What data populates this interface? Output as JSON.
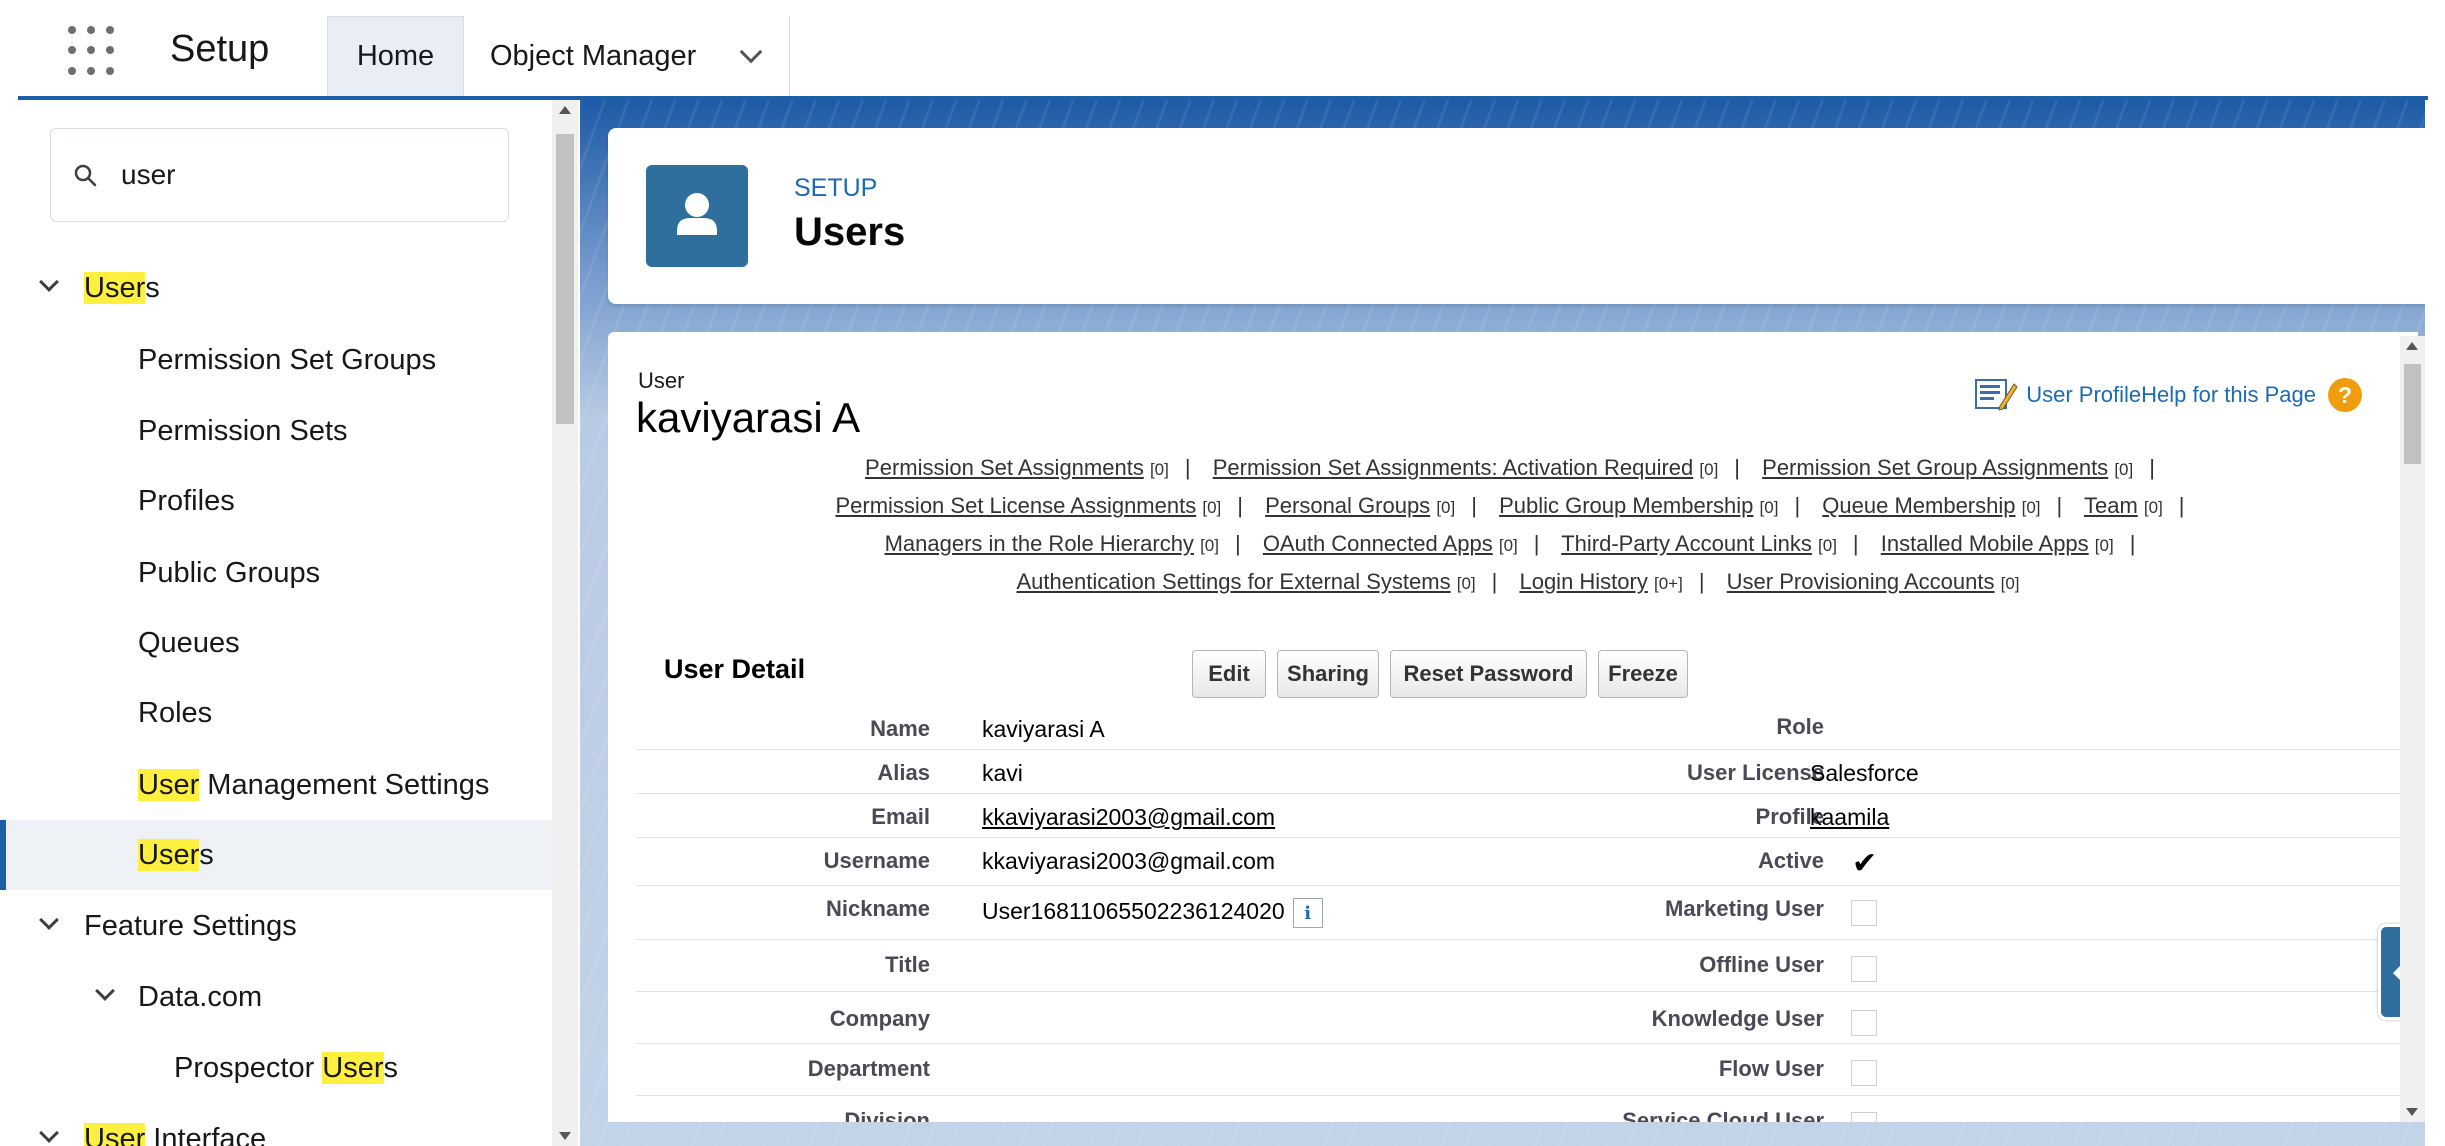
{
  "topbar": {
    "app_title": "Setup",
    "tabs": [
      {
        "label": "Home"
      },
      {
        "label": "Object Manager"
      }
    ]
  },
  "sidebar": {
    "search": {
      "value": "user"
    },
    "items": [
      {
        "pre": "",
        "highlight": "User",
        "post": "s"
      },
      {
        "pre": "Permission Set Groups",
        "highlight": "",
        "post": ""
      },
      {
        "pre": "Permission Sets",
        "highlight": "",
        "post": ""
      },
      {
        "pre": "Profiles",
        "highlight": "",
        "post": ""
      },
      {
        "pre": "Public Groups",
        "highlight": "",
        "post": ""
      },
      {
        "pre": "Queues",
        "highlight": "",
        "post": ""
      },
      {
        "pre": "Roles",
        "highlight": "",
        "post": ""
      },
      {
        "pre": "",
        "highlight": "User",
        "post": " Management Settings"
      },
      {
        "pre": "",
        "highlight": "User",
        "post": "s"
      },
      {
        "pre": "Feature Settings",
        "highlight": "",
        "post": ""
      },
      {
        "pre": "Data.com",
        "highlight": "",
        "post": ""
      },
      {
        "pre": "Prospector ",
        "highlight": "User",
        "post": "s"
      },
      {
        "pre": "",
        "highlight": "User",
        "post": " Interface"
      }
    ]
  },
  "header": {
    "setup_label": "SETUP",
    "title": "Users"
  },
  "detail": {
    "object_label": "User",
    "user_name": "kaviyarasi A",
    "help": {
      "profile_link": "User ProfileHelp for this Page",
      "help_icon": "?"
    },
    "related_links": [
      {
        "label": "Permission Set Assignments",
        "count": "[0]"
      },
      {
        "label": "Permission Set Assignments: Activation Required",
        "count": "[0]"
      },
      {
        "label": "Permission Set Group Assignments",
        "count": "[0]"
      },
      {
        "label": "Permission Set License Assignments",
        "count": "[0]"
      },
      {
        "label": "Personal Groups",
        "count": "[0]"
      },
      {
        "label": "Public Group Membership",
        "count": "[0]"
      },
      {
        "label": "Queue Membership",
        "count": "[0]"
      },
      {
        "label": "Team",
        "count": "[0]"
      },
      {
        "label": "Managers in the Role Hierarchy",
        "count": "[0]"
      },
      {
        "label": "OAuth Connected Apps",
        "count": "[0]"
      },
      {
        "label": "Third-Party Account Links",
        "count": "[0]"
      },
      {
        "label": "Installed Mobile Apps",
        "count": "[0]"
      },
      {
        "label": "Authentication Settings for External Systems",
        "count": "[0]"
      },
      {
        "label": "Login History",
        "count": "[0+]"
      },
      {
        "label": "User Provisioning Accounts",
        "count": "[0]"
      }
    ],
    "section_title": "User Detail",
    "buttons": {
      "edit": "Edit",
      "sharing": "Sharing",
      "reset_password": "Reset Password",
      "freeze": "Freeze"
    },
    "fields_left": [
      {
        "label": "Name",
        "value": "kaviyarasi A"
      },
      {
        "label": "Alias",
        "value": "kavi"
      },
      {
        "label": "Email",
        "value": "kkaviyarasi2003@gmail.com"
      },
      {
        "label": "Username",
        "value": "kkaviyarasi2003@gmail.com"
      },
      {
        "label": "Nickname",
        "value": "User16811065502236124020",
        "info": "i"
      },
      {
        "label": "Title",
        "value": ""
      },
      {
        "label": "Company",
        "value": ""
      },
      {
        "label": "Department",
        "value": ""
      },
      {
        "label": "Division",
        "value": ""
      }
    ],
    "fields_right": [
      {
        "label": "Role",
        "value": ""
      },
      {
        "label": "User License",
        "value": "Salesforce"
      },
      {
        "label": "Profile",
        "value": "kaamila"
      },
      {
        "label": "Active",
        "value": "✔"
      },
      {
        "label": "Marketing User",
        "value": ""
      },
      {
        "label": "Offline User",
        "value": ""
      },
      {
        "label": "Knowledge User",
        "value": ""
      },
      {
        "label": "Flow User",
        "value": ""
      },
      {
        "label": "Service Cloud User",
        "value": ""
      }
    ]
  },
  "colors": {
    "brand_blue": "#1b5fa8",
    "icon_blue": "#2f6f9e",
    "link_blue": "#1b6bb5",
    "highlight": "#fff03f",
    "help_orange": "#ef9d0f"
  }
}
